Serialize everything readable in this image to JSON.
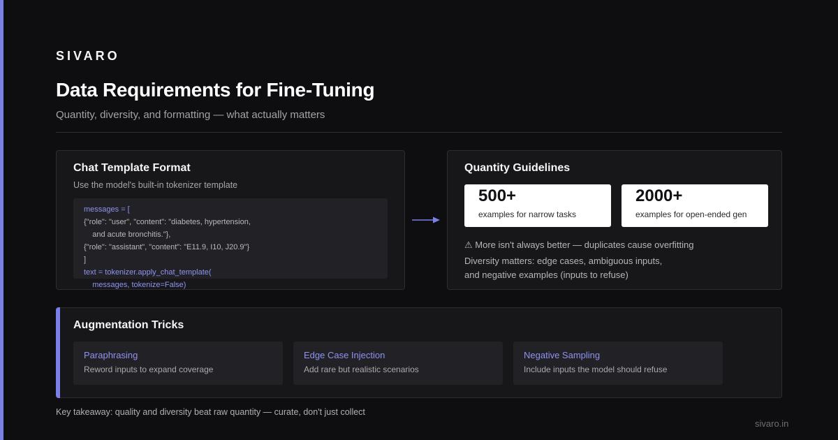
{
  "brand": "SIVARO",
  "title": "Data Requirements for Fine-Tuning",
  "subtitle": "Quantity, diversity, and formatting — what actually matters",
  "chat_template": {
    "title": "Chat Template Format",
    "subtitle": "Use the model's built-in tokenizer template",
    "code_lines": [
      "messages = [",
      "{\"role\": \"user\", \"content\": \"diabetes, hypertension,",
      "    and acute bronchitis.\"},",
      "{\"role\": \"assistant\", \"content\": \"E11.9, I10, J20.9\"}",
      "]",
      "text = tokenizer.apply_chat_template(",
      "    messages, tokenize=False)"
    ]
  },
  "quantity": {
    "title": "Quantity Guidelines",
    "stats": [
      {
        "value": "500+",
        "label": "examples for narrow tasks"
      },
      {
        "value": "2000+",
        "label": "examples for open-ended gen"
      }
    ],
    "warning": "⚠ More isn't always better — duplicates cause overfitting",
    "diversity_line1": "Diversity matters: edge cases, ambiguous inputs,",
    "diversity_line2": "and negative examples (inputs to refuse)"
  },
  "augmentation": {
    "title": "Augmentation Tricks",
    "items": [
      {
        "name": "Paraphrasing",
        "desc": "Reword inputs to expand coverage"
      },
      {
        "name": "Edge Case Injection",
        "desc": "Add rare but realistic scenarios"
      },
      {
        "name": "Negative Sampling",
        "desc": "Include inputs the model should refuse"
      }
    ]
  },
  "takeaway": "Key takeaway: quality and diversity beat raw quantity — curate, don't just collect",
  "domain": "sivaro.in",
  "colors": {
    "accent": "#7b7fe8",
    "background": "#0e0e10",
    "card": "#17171a"
  }
}
